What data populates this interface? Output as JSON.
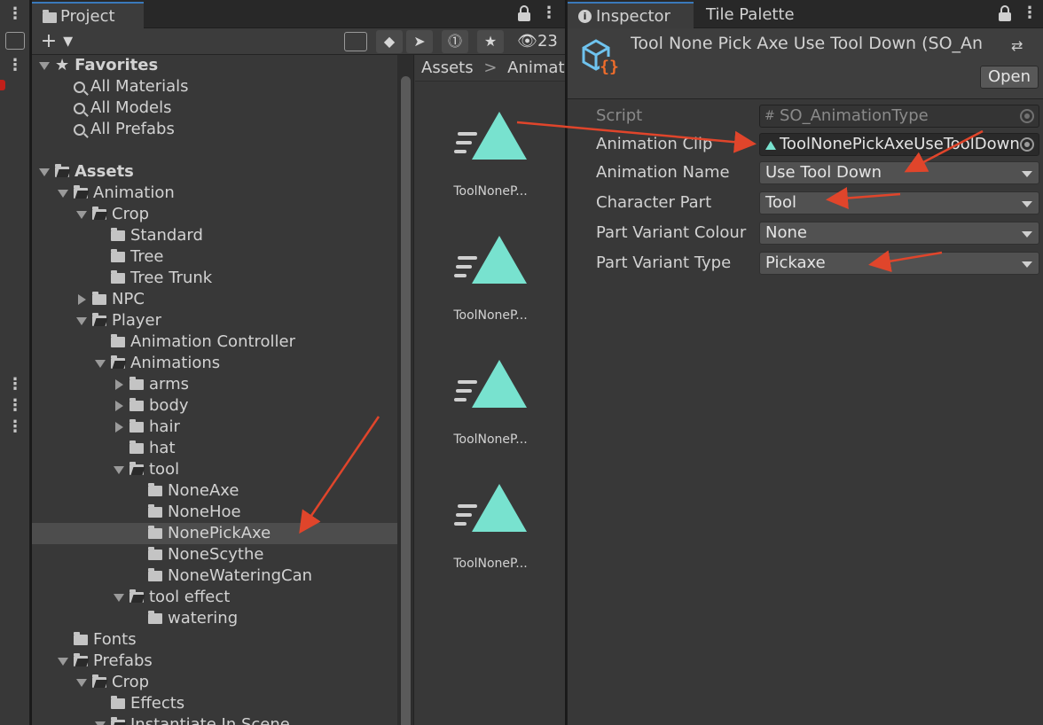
{
  "left_strip": {
    "kebab_icon": "vertical-dots-icon"
  },
  "project": {
    "tab_label": "Project",
    "visible_count": "23",
    "tree": [
      {
        "label": "Favorites",
        "depth": 0,
        "expand": "down",
        "icon": "star-icon",
        "bold": true
      },
      {
        "label": "All Materials",
        "depth": 1,
        "expand": "none",
        "icon": "search-icon"
      },
      {
        "label": "All Models",
        "depth": 1,
        "expand": "none",
        "icon": "search-icon"
      },
      {
        "label": "All Prefabs",
        "depth": 1,
        "expand": "none",
        "icon": "search-icon"
      },
      {
        "label": "",
        "depth": 0,
        "expand": "gap",
        "icon": ""
      },
      {
        "label": "Assets",
        "depth": 0,
        "expand": "down",
        "icon": "folder-open-icon",
        "bold": true
      },
      {
        "label": "Animation",
        "depth": 1,
        "expand": "down",
        "icon": "folder-open-icon"
      },
      {
        "label": "Crop",
        "depth": 2,
        "expand": "down",
        "icon": "folder-open-icon"
      },
      {
        "label": "Standard",
        "depth": 3,
        "expand": "none",
        "icon": "folder-icon"
      },
      {
        "label": "Tree",
        "depth": 3,
        "expand": "none",
        "icon": "folder-icon"
      },
      {
        "label": "Tree Trunk",
        "depth": 3,
        "expand": "none",
        "icon": "folder-icon"
      },
      {
        "label": "NPC",
        "depth": 2,
        "expand": "right",
        "icon": "folder-icon"
      },
      {
        "label": "Player",
        "depth": 2,
        "expand": "down",
        "icon": "folder-open-icon"
      },
      {
        "label": "Animation Controller",
        "depth": 3,
        "expand": "none",
        "icon": "folder-icon"
      },
      {
        "label": "Animations",
        "depth": 3,
        "expand": "down",
        "icon": "folder-open-icon"
      },
      {
        "label": "arms",
        "depth": 4,
        "expand": "right",
        "icon": "folder-icon"
      },
      {
        "label": "body",
        "depth": 4,
        "expand": "right",
        "icon": "folder-icon"
      },
      {
        "label": "hair",
        "depth": 4,
        "expand": "right",
        "icon": "folder-icon"
      },
      {
        "label": "hat",
        "depth": 4,
        "expand": "none",
        "icon": "folder-icon"
      },
      {
        "label": "tool",
        "depth": 4,
        "expand": "down",
        "icon": "folder-open-icon"
      },
      {
        "label": "NoneAxe",
        "depth": 5,
        "expand": "none",
        "icon": "folder-icon"
      },
      {
        "label": "NoneHoe",
        "depth": 5,
        "expand": "none",
        "icon": "folder-icon"
      },
      {
        "label": "NonePickAxe",
        "depth": 5,
        "expand": "none",
        "icon": "folder-icon",
        "selected": true
      },
      {
        "label": "NoneScythe",
        "depth": 5,
        "expand": "none",
        "icon": "folder-icon"
      },
      {
        "label": "NoneWateringCan",
        "depth": 5,
        "expand": "none",
        "icon": "folder-icon"
      },
      {
        "label": "tool effect",
        "depth": 4,
        "expand": "down",
        "icon": "folder-open-icon"
      },
      {
        "label": "watering",
        "depth": 5,
        "expand": "none",
        "icon": "folder-icon"
      },
      {
        "label": "Fonts",
        "depth": 1,
        "expand": "none",
        "icon": "folder-icon"
      },
      {
        "label": "Prefabs",
        "depth": 1,
        "expand": "down",
        "icon": "folder-open-icon"
      },
      {
        "label": "Crop",
        "depth": 2,
        "expand": "down",
        "icon": "folder-open-icon"
      },
      {
        "label": "Effects",
        "depth": 3,
        "expand": "none",
        "icon": "folder-icon"
      },
      {
        "label": "Instantiate In Scene",
        "depth": 3,
        "expand": "down",
        "icon": "folder-open-icon"
      }
    ],
    "breadcrumb": [
      "Assets",
      "Animation"
    ],
    "breadcrumb_sep": ">",
    "assets": [
      {
        "label": "ToolNoneP..."
      },
      {
        "label": "ToolNoneP..."
      },
      {
        "label": "ToolNoneP..."
      },
      {
        "label": "ToolNoneP..."
      }
    ]
  },
  "inspector": {
    "tab_inspector": "Inspector",
    "tab_palette": "Tile Palette",
    "title": "Tool None Pick Axe Use Tool Down (SO_An",
    "open_button": "Open",
    "script_label": "Script",
    "script_value": "SO_AnimationType",
    "clip_label": "Animation Clip",
    "clip_value": "ToolNonePickAxeUseToolDown",
    "fields": [
      {
        "label": "Animation Name",
        "value": "Use Tool Down"
      },
      {
        "label": "Character Part",
        "value": "Tool"
      },
      {
        "label": "Part Variant Colour",
        "value": "None"
      },
      {
        "label": "Part Variant Type",
        "value": "Pickaxe"
      }
    ]
  },
  "colors": {
    "annotation_arrow": "#e0452b",
    "anim_clip_icon": "#78e2cf",
    "accent_tab": "#3a79bb"
  }
}
